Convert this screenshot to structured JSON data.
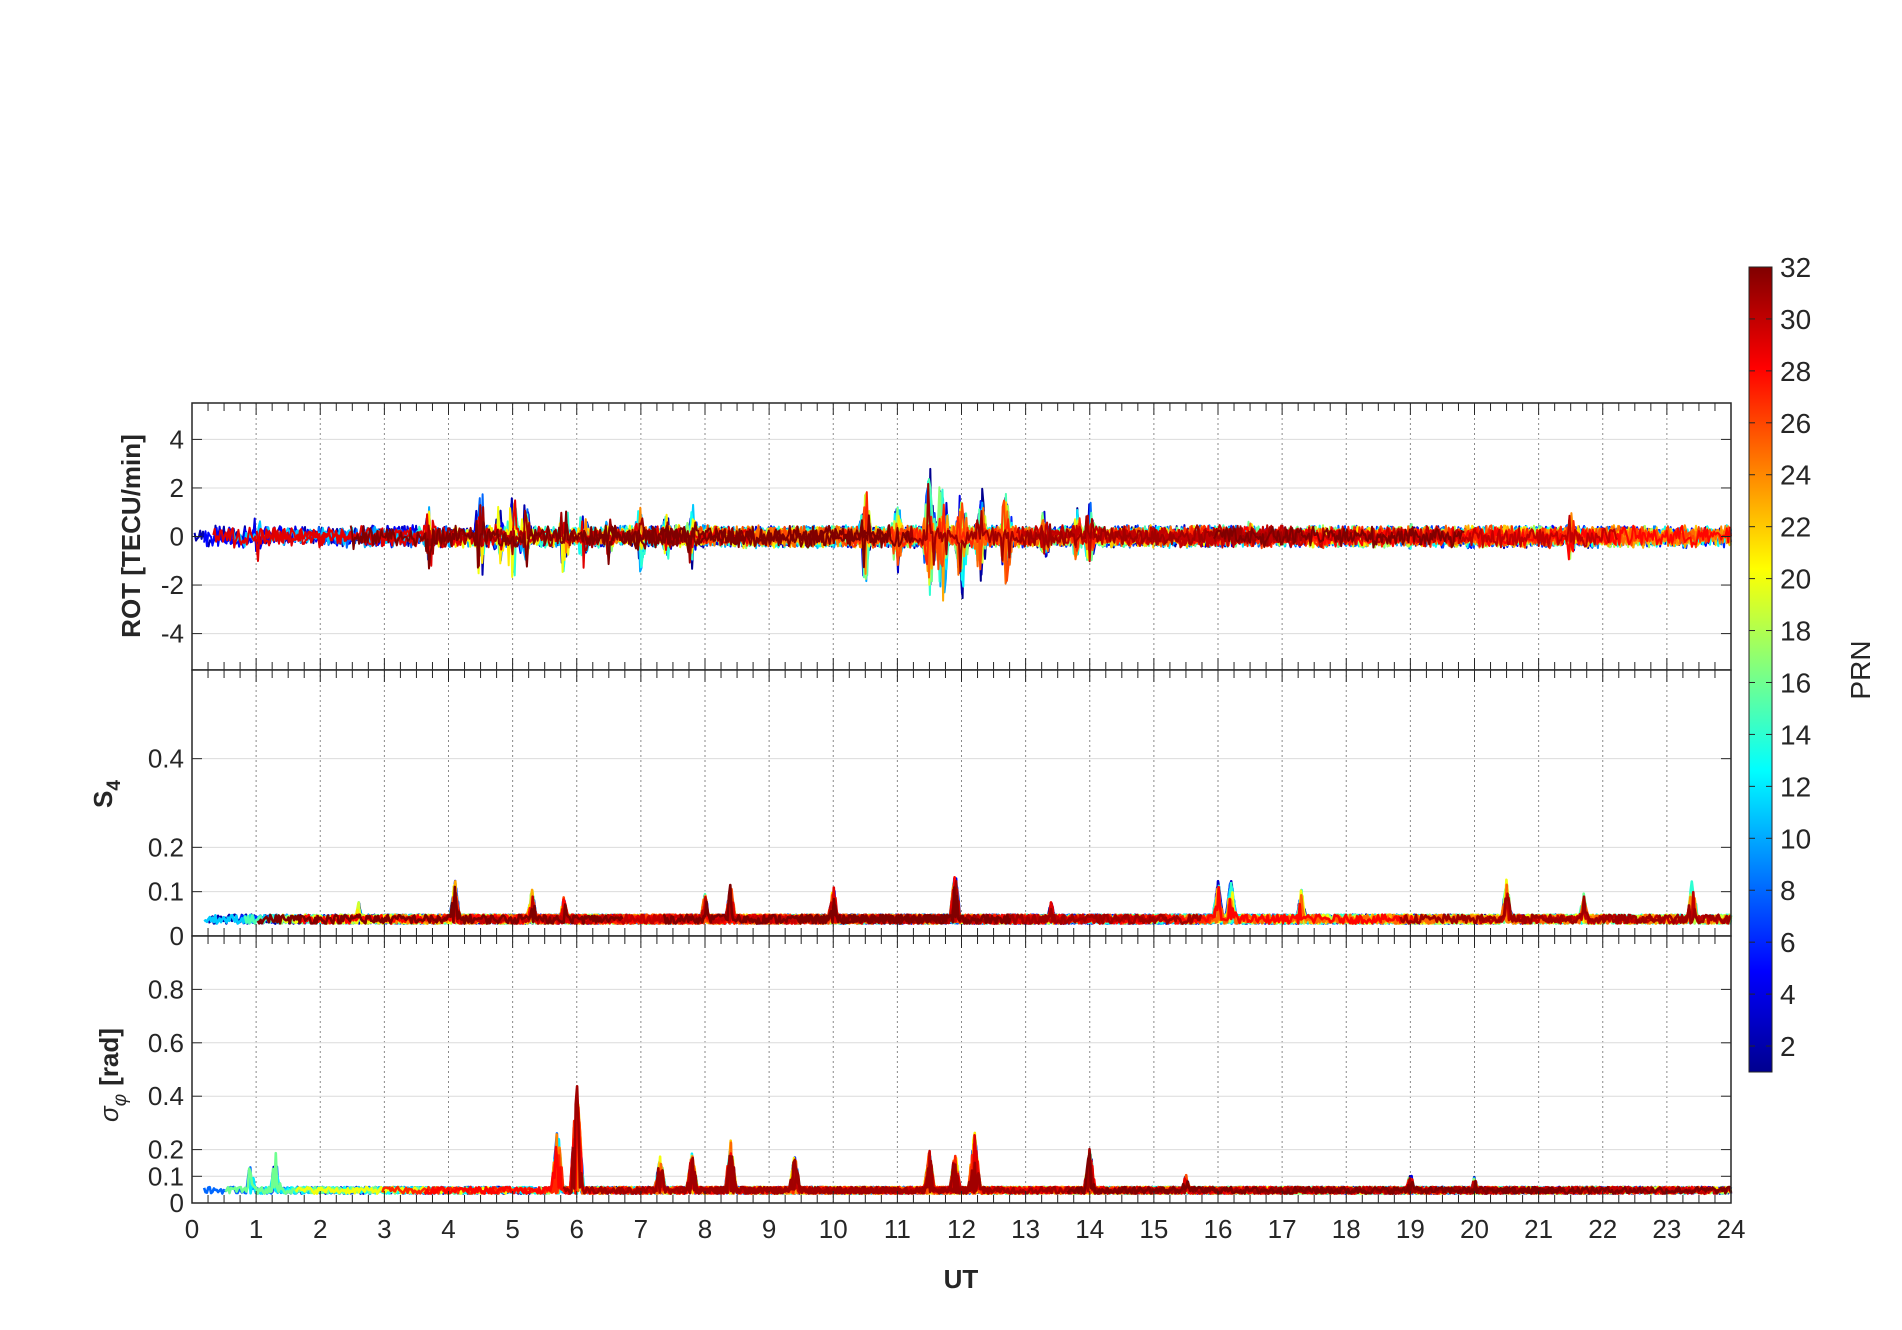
{
  "chart_data": [
    {
      "type": "line",
      "panel": "rot",
      "ylabel": "ROT [TECU/min]",
      "ylim": [
        -5.5,
        5.5
      ],
      "yticks": [
        -4,
        -2,
        0,
        2,
        4
      ],
      "ytick_labels": [
        "-4",
        "-2",
        "0",
        "2",
        "4"
      ],
      "x_unit": "hours UT",
      "xlim": [
        0,
        24
      ],
      "grid": "on",
      "baseline_amplitude": 0.35,
      "events": [
        {
          "x": 0.5,
          "amp": 0.8
        },
        {
          "x": 1.0,
          "amp": 1.4
        },
        {
          "x": 2.0,
          "amp": 0.7
        },
        {
          "x": 2.5,
          "amp": 0.8
        },
        {
          "x": 3.7,
          "amp": 1.9
        },
        {
          "x": 4.5,
          "amp": 3.0
        },
        {
          "x": 4.8,
          "amp": 2.0
        },
        {
          "x": 5.0,
          "amp": 2.8
        },
        {
          "x": 5.2,
          "amp": 2.3
        },
        {
          "x": 5.8,
          "amp": 2.2
        },
        {
          "x": 6.1,
          "amp": 1.6
        },
        {
          "x": 6.5,
          "amp": 1.4
        },
        {
          "x": 7.0,
          "amp": 2.1
        },
        {
          "x": 7.4,
          "amp": 1.6
        },
        {
          "x": 7.8,
          "amp": 1.7
        },
        {
          "x": 10.5,
          "amp": 2.5
        },
        {
          "x": 11.0,
          "amp": 2.0
        },
        {
          "x": 11.5,
          "amp": 4.0
        },
        {
          "x": 11.7,
          "amp": 3.6
        },
        {
          "x": 12.0,
          "amp": 3.4
        },
        {
          "x": 12.3,
          "amp": 2.7
        },
        {
          "x": 12.7,
          "amp": 2.7
        },
        {
          "x": 13.3,
          "amp": 1.6
        },
        {
          "x": 13.8,
          "amp": 1.6
        },
        {
          "x": 14.0,
          "amp": 1.8
        },
        {
          "x": 16.5,
          "amp": 0.9
        },
        {
          "x": 19.0,
          "amp": 0.9
        },
        {
          "x": 21.5,
          "amp": 1.3
        }
      ]
    },
    {
      "type": "line",
      "panel": "s4",
      "ylabel": "S",
      "ylabel_sub": "4",
      "ylim": [
        0,
        0.6
      ],
      "yticks": [
        0,
        0.1,
        0.2,
        0.4
      ],
      "ytick_labels": [
        "0",
        "0.1",
        "0.2",
        "0.4"
      ],
      "x_unit": "hours UT",
      "xlim": [
        0,
        24
      ],
      "grid": "on",
      "baseline": 0.04,
      "events": [
        {
          "x": 2.6,
          "amp": 0.08
        },
        {
          "x": 4.1,
          "amp": 0.13
        },
        {
          "x": 5.3,
          "amp": 0.11
        },
        {
          "x": 5.8,
          "amp": 0.09
        },
        {
          "x": 8.0,
          "amp": 0.1
        },
        {
          "x": 8.4,
          "amp": 0.12
        },
        {
          "x": 10.0,
          "amp": 0.12
        },
        {
          "x": 11.9,
          "amp": 0.15
        },
        {
          "x": 13.4,
          "amp": 0.08
        },
        {
          "x": 16.0,
          "amp": 0.13
        },
        {
          "x": 16.2,
          "amp": 0.135
        },
        {
          "x": 17.3,
          "amp": 0.11
        },
        {
          "x": 20.5,
          "amp": 0.13
        },
        {
          "x": 21.7,
          "amp": 0.1
        },
        {
          "x": 23.4,
          "amp": 0.14
        }
      ]
    },
    {
      "type": "line",
      "panel": "sigma_phi",
      "ylabel": "[rad]",
      "ylabel_symbol": "σ",
      "ylabel_sub": "φ",
      "ylim": [
        0,
        1
      ],
      "yticks": [
        0,
        0.1,
        0.2,
        0.4,
        0.6,
        0.8
      ],
      "ytick_labels": [
        "0",
        "0.1",
        "0.2",
        "0.4",
        "0.6",
        "0.8"
      ],
      "xlabel": "UT",
      "xticks": [
        0,
        1,
        2,
        3,
        4,
        5,
        6,
        7,
        8,
        9,
        10,
        11,
        12,
        13,
        14,
        15,
        16,
        17,
        18,
        19,
        20,
        21,
        22,
        23,
        24
      ],
      "xtick_labels": [
        "0",
        "1",
        "2",
        "3",
        "4",
        "5",
        "6",
        "7",
        "8",
        "9",
        "10",
        "11",
        "12",
        "13",
        "14",
        "15",
        "16",
        "17",
        "18",
        "19",
        "20",
        "21",
        "22",
        "23",
        "24"
      ],
      "x_unit": "hours UT",
      "xlim": [
        0,
        24
      ],
      "grid": "on",
      "baseline": 0.05,
      "events": [
        {
          "x": 0.9,
          "amp": 0.19
        },
        {
          "x": 1.3,
          "amp": 0.2
        },
        {
          "x": 5.7,
          "amp": 0.29
        },
        {
          "x": 6.0,
          "amp": 0.47
        },
        {
          "x": 7.3,
          "amp": 0.19
        },
        {
          "x": 7.8,
          "amp": 0.2
        },
        {
          "x": 8.4,
          "amp": 0.24
        },
        {
          "x": 9.4,
          "amp": 0.19
        },
        {
          "x": 11.5,
          "amp": 0.2
        },
        {
          "x": 11.9,
          "amp": 0.2
        },
        {
          "x": 12.2,
          "amp": 0.28
        },
        {
          "x": 14.0,
          "amp": 0.21
        },
        {
          "x": 15.5,
          "amp": 0.11
        },
        {
          "x": 19.0,
          "amp": 0.12
        },
        {
          "x": 20.0,
          "amp": 0.1
        }
      ]
    }
  ],
  "colorbar": {
    "label": "PRN",
    "range": [
      1,
      32
    ],
    "ticks": [
      2,
      4,
      6,
      8,
      10,
      12,
      14,
      16,
      18,
      20,
      22,
      24,
      26,
      28,
      30,
      32
    ],
    "tick_labels": [
      "2",
      "4",
      "6",
      "8",
      "10",
      "12",
      "14",
      "16",
      "18",
      "20",
      "22",
      "24",
      "26",
      "28",
      "30",
      "32"
    ],
    "colormap": "jet",
    "colors": [
      "#00008f",
      "#0000ff",
      "#0080ff",
      "#00ffff",
      "#80ff80",
      "#ffff00",
      "#ff8000",
      "#ff0000",
      "#800000"
    ]
  }
}
